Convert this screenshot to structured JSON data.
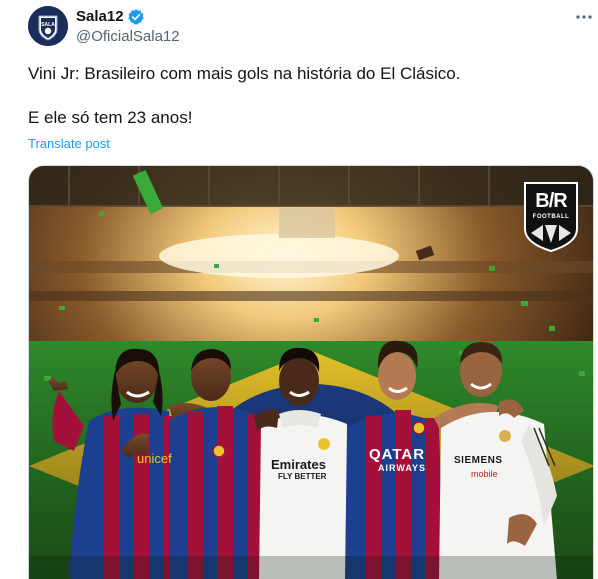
{
  "post": {
    "display_name": "Sala12",
    "handle": "@OficialSala12",
    "text_line1": "Vini Jr: Brasileiro com mais gols na história do El Clásico.",
    "text_line2": "E ele só tem 23 anos!",
    "translate_label": "Translate post",
    "avatar_text": "SALA",
    "icons": {
      "avatar": "club-crest-icon",
      "verified": "verified-badge-icon",
      "more": "more-options-icon"
    }
  },
  "media": {
    "logo_text": "B/R",
    "logo_subtext": "FOOTBALL",
    "kits": {
      "player1_sponsor": "unicef",
      "player3_sponsor_top": "Emirates",
      "player3_sponsor_bottom": "FLY BETTER",
      "player4_sponsor_top": "QATAR",
      "player4_sponsor_bottom": "AIRWAYS",
      "player5_sponsor_top": "SIEMENS",
      "player5_sponsor_bottom": "mobile"
    }
  },
  "colors": {
    "link": "#1d9bf0",
    "secondary_text": "#536471",
    "barca_blue": "#1c3f8f",
    "barca_red": "#a3103a",
    "brazil_green": "#2f8a2a",
    "brazil_yellow": "#e9c42a"
  }
}
